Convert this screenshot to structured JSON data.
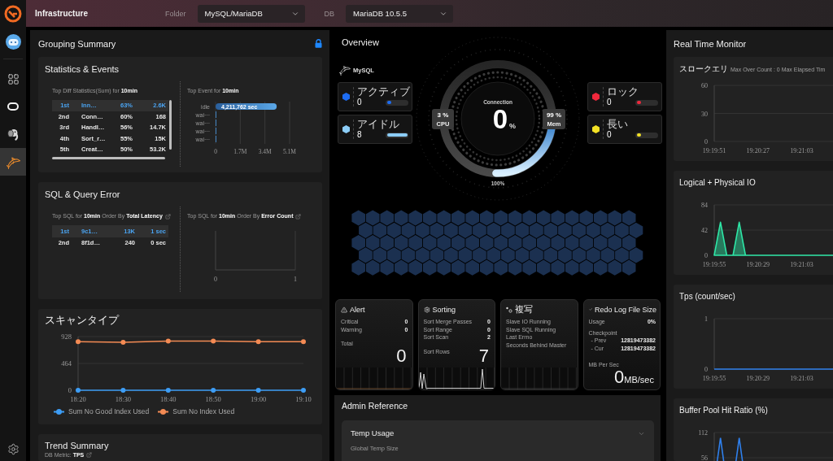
{
  "sidebar": {
    "items": [
      {
        "selected": false
      },
      {
        "selected": false
      },
      {
        "selected": false
      },
      {
        "selected": true
      }
    ]
  },
  "header": {
    "title": "Infrastructure",
    "filters": [
      {
        "label": "Folder",
        "value": "MySQL/MariaDB"
      },
      {
        "label": "DB",
        "value": "MariaDB 10.5.5"
      }
    ]
  },
  "grouping_summary": {
    "title": "Grouping Summary",
    "statistics_events": {
      "title": "Statistics & Events",
      "top_diff": {
        "title": "Top Diff Statistics(Sum) for **10min**",
        "rows": [
          {
            "rank": "1st",
            "name": "Inn…",
            "percent": "63%",
            "value": "2.6K",
            "selected": true
          },
          {
            "rank": "2nd",
            "name": "Conn…",
            "percent": "60%",
            "value": "168",
            "selected": false
          },
          {
            "rank": "3rd",
            "name": "Handl…",
            "percent": "56%",
            "value": "14.7K",
            "selected": false
          },
          {
            "rank": "4th",
            "name": "Sort_r…",
            "percent": "55%",
            "value": "15K",
            "selected": false
          },
          {
            "rank": "5th",
            "name": "Creat…",
            "percent": "50%",
            "value": "53.2K",
            "selected": false
          }
        ]
      },
      "top_event": {
        "title": "Top Event for **10min**",
        "chart_data": {
          "type": "bar",
          "orientation": "horizontal",
          "categories": [
            "idle",
            "wai···",
            "wai···",
            "wai···",
            "wai···"
          ],
          "values": [
            4211762,
            0,
            0,
            0,
            0
          ],
          "xlim": [
            0,
            5100000
          ],
          "xticks": [
            0,
            {
              "value": 1700000,
              "label": "1.7M"
            },
            {
              "value": 3400000,
              "label": "3.4M"
            },
            {
              "value": 5100000,
              "label": "5.1M"
            }
          ],
          "value_labels": [
            "4,211,762 sec",
            null,
            null,
            null,
            null
          ]
        }
      }
    },
    "sql_query_error": {
      "title": "SQL & Query Error",
      "top_latency": {
        "title": "Top SQL for **10min** Order By **Total Latency**",
        "rows": [
          {
            "rank": "1st",
            "digest": "9c1…",
            "count": "13K",
            "latency": "1 sec",
            "selected": true
          },
          {
            "rank": "2nd",
            "digest": "8f1d…",
            "count": "240",
            "latency": "0 sec",
            "selected": false
          }
        ]
      },
      "top_error": {
        "title": "Top SQL for **10min** Order By **Error Count**",
        "axis_labels": [
          "0",
          "1"
        ]
      }
    },
    "scan_type": {
      "title": "スキャンタイプ",
      "chart_data": {
        "type": "line",
        "categories": [
          "18:20",
          "18:30",
          "18:40",
          "18:50",
          "19:00",
          "19:10"
        ],
        "ylim": [
          0,
          928
        ],
        "yticks": [
          0,
          464,
          928
        ],
        "series": [
          {
            "name": "Sum No Good Index Used",
            "color": "#3d9df5",
            "marker": "circle",
            "values": [
              0,
              0,
              0,
              0,
              0,
              0
            ]
          },
          {
            "name": "Sum No Index Used",
            "color": "#f48b54",
            "marker": "circle",
            "values": [
              840,
              830,
              850,
              850,
              840,
              840
            ]
          }
        ]
      }
    },
    "trend_summary": {
      "title": "Trend Summary",
      "metric": "DB Metric: **TPS**"
    }
  },
  "overview": {
    "title": "Overview",
    "db_type": "MySQL",
    "left_cards": [
      {
        "label": "アクティブ",
        "value": "0",
        "color": "#1d6cf2",
        "level": 0.2
      },
      {
        "label": "アイドル",
        "value": "8",
        "color": "#8ccdf7",
        "level": 1
      }
    ],
    "right_cards": [
      {
        "label": "ロック",
        "value": "0",
        "color": "#f0283c",
        "level": 0.2
      },
      {
        "label": "長い",
        "value": "0",
        "color": "#f3e125",
        "level": 0.2
      }
    ],
    "gauge": {
      "title": "Connection",
      "value": "0",
      "unit": "%",
      "cpu": {
        "value": "3 %",
        "label": "CPU"
      },
      "mem": {
        "value": "99 %",
        "label": "Mem"
      },
      "scale_label": "100%"
    }
  },
  "metric_cards": [
    {
      "kind": "alert",
      "title": "Alert",
      "rows": [
        {
          "label": "Critical",
          "value": "0"
        },
        {
          "label": "Warning",
          "value": "0"
        }
      ],
      "total_label": "Total",
      "total": "0"
    },
    {
      "kind": "sorting",
      "title": "Sorting",
      "rows": [
        {
          "label": "Sort Merge Passes",
          "value": "0"
        },
        {
          "label": "Sort Range",
          "value": "0"
        },
        {
          "label": "Sort Scan",
          "value": "2"
        }
      ],
      "total_label": "Sort Rows",
      "total": "7"
    },
    {
      "kind": "replication",
      "title": "複写",
      "rows": [
        {
          "label": "Slave IO Running"
        },
        {
          "label": "Slave SQL Running"
        },
        {
          "label": "Last Errno"
        },
        {
          "label": "Seconds Behind Master"
        }
      ]
    },
    {
      "kind": "redo",
      "title": "Redo Log File Size",
      "rows": [
        {
          "label": "Usage",
          "value": "0%"
        }
      ],
      "checkpoint": {
        "label": "Checkpoint",
        "rows": [
          {
            "label": "- Prev",
            "value": "12819473382"
          },
          {
            "label": "- Cur",
            "value": "12819473382"
          }
        ]
      },
      "total_label": "MB Per Sec",
      "total": "0",
      "unit": "MB/sec"
    }
  ],
  "admin_reference": {
    "title": "Admin Reference",
    "sections": [
      {
        "title": "Temp Usage",
        "rows": [
          "Global Temp Size"
        ]
      }
    ]
  },
  "real_time_monitor": {
    "title": "Real Time Monitor",
    "charts": [
      {
        "title": "スロークエリ",
        "subtitle": "Max Over Count : 0 Max Elapsed Tim",
        "chart_data": {
          "type": "line",
          "categories": [
            "19:19:51",
            null,
            null,
            null,
            null,
            null,
            null,
            "19:20:27",
            null,
            null,
            null,
            null,
            null,
            null,
            "19:21:03",
            null,
            null,
            null,
            null,
            null
          ],
          "ylim": [
            0,
            60
          ],
          "yticks": [
            0,
            30,
            60
          ]
        }
      },
      {
        "title": "Logical + Physical IO",
        "chart_data": {
          "type": "area",
          "categories": [
            "19:19:55",
            null,
            null,
            null,
            null,
            null,
            null,
            "19:20:29",
            null,
            null,
            null,
            null,
            null,
            null,
            "19:21:03",
            null,
            null,
            null,
            null,
            null
          ],
          "ylim": [
            0,
            84
          ],
          "yticks": [
            0,
            42,
            84
          ],
          "series": [
            {
              "color": "#2ee6a6",
              "values": [
                0,
                55,
                0,
                0,
                55,
                0,
                0,
                0,
                0,
                0,
                0,
                0,
                0,
                0,
                0,
                0,
                0,
                0,
                0,
                0
              ]
            }
          ]
        }
      },
      {
        "title": "Tps (count/sec)",
        "chart_data": {
          "type": "line",
          "categories": [
            "19:19:55",
            null,
            null,
            null,
            null,
            null,
            null,
            "19:20:29",
            null,
            null,
            null,
            null,
            null,
            null,
            "19:21:03",
            null,
            null,
            null,
            null,
            null
          ],
          "ylim": [
            0,
            1
          ],
          "yticks": [
            0,
            1
          ],
          "series": [
            {
              "color": "#2f80ed",
              "values": [
                0,
                0,
                0,
                0,
                0,
                0,
                0,
                0,
                0,
                0,
                0,
                0,
                0,
                0,
                0,
                0,
                0,
                0,
                0,
                0
              ]
            }
          ]
        }
      },
      {
        "title": "Buffer Pool Hit Ratio (%)",
        "axis_labels": [
          "112",
          "56"
        ]
      }
    ]
  }
}
